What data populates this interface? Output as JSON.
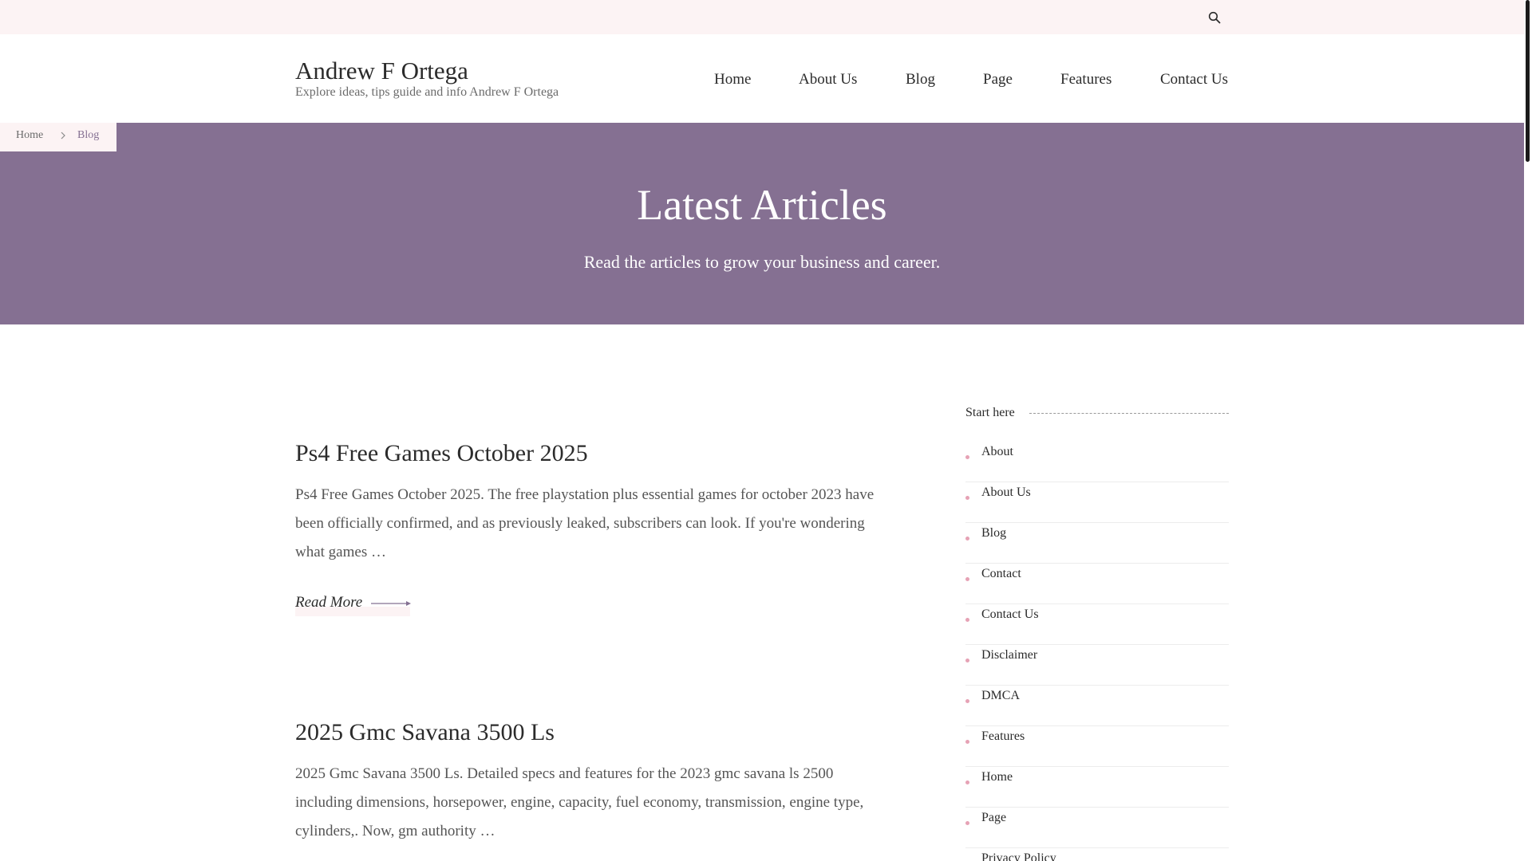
{
  "search": {
    "icon": "search-icon"
  },
  "site": {
    "title": "Andrew F Ortega",
    "tagline": "Explore ideas, tips guide and info Andrew F Ortega"
  },
  "nav": {
    "items": [
      {
        "label": "Home"
      },
      {
        "label": "About Us"
      },
      {
        "label": "Blog"
      },
      {
        "label": "Page"
      },
      {
        "label": "Features"
      },
      {
        "label": "Contact Us"
      }
    ]
  },
  "breadcrumb": {
    "home": "Home",
    "current": "Blog"
  },
  "hero": {
    "title": "Latest Articles",
    "subtitle": "Read the articles to grow your business and career."
  },
  "articles": [
    {
      "title": "Ps4 Free Games October 2025",
      "excerpt": "Ps4 Free Games October 2025. The free playstation plus essential games for october 2023 have been officially confirmed, and as previously leaked, subscribers can look. If you're wondering what games …",
      "read_more": "Read More"
    },
    {
      "title": "2025 Gmc Savana 3500 Ls",
      "excerpt": "2025 Gmc Savana 3500 Ls. Detailed specs and features for the 2023 gmc savana ls 2500 including dimensions, horsepower, engine, capacity, fuel economy, transmission, engine type, cylinders,. Now, gm authority …"
    }
  ],
  "sidebar": {
    "title": "Start here",
    "items": [
      {
        "label": "About"
      },
      {
        "label": "About Us"
      },
      {
        "label": "Blog"
      },
      {
        "label": "Contact"
      },
      {
        "label": "Contact Us"
      },
      {
        "label": "Disclaimer"
      },
      {
        "label": "DMCA"
      },
      {
        "label": "Features"
      },
      {
        "label": "Home"
      },
      {
        "label": "Page"
      },
      {
        "label": "Privacy Policy"
      }
    ]
  },
  "colors": {
    "hero_bg": "#857092",
    "topbar_bg": "#fcf3f4",
    "bullet": "#e6a2b5"
  }
}
